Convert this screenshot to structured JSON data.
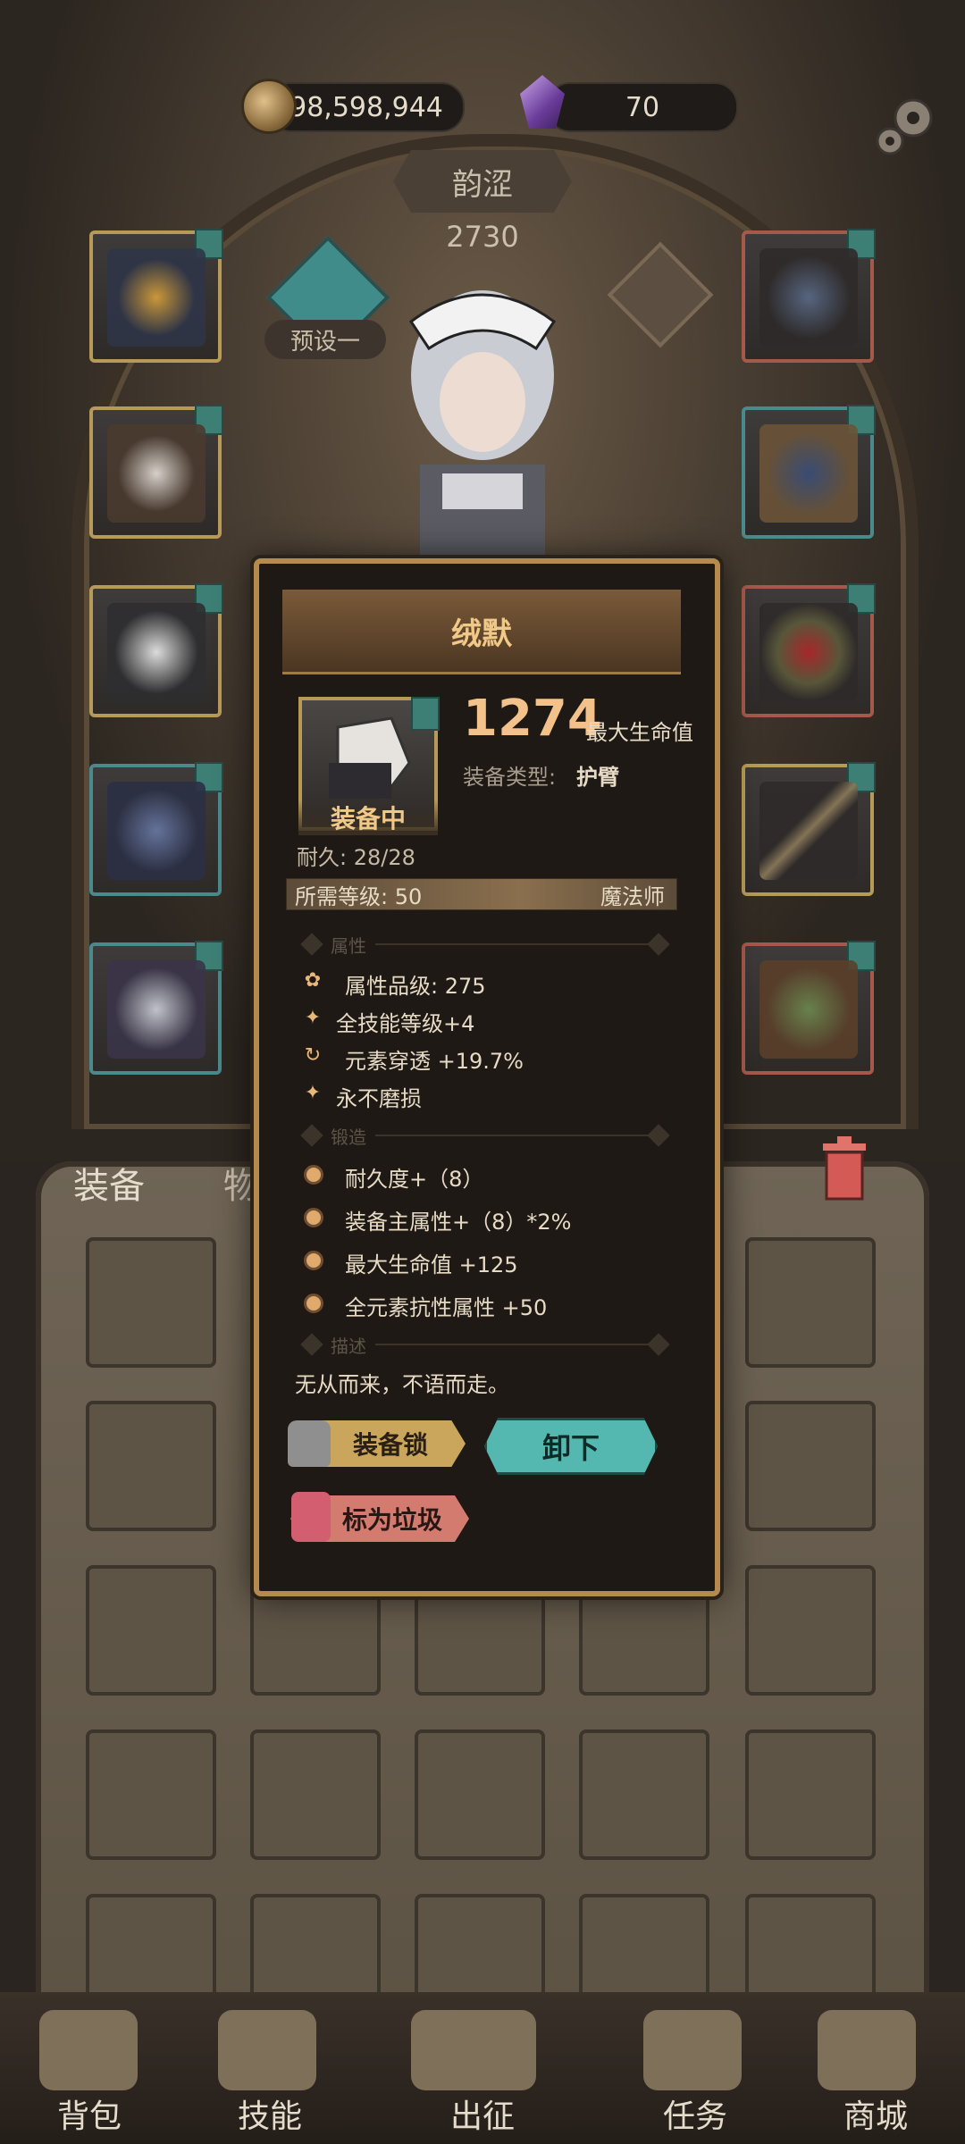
{
  "currency": {
    "gold": "98,598,944",
    "gems": "70"
  },
  "character": {
    "name": "韵涩",
    "level": "2730",
    "preset_label": "预设一"
  },
  "tabs": {
    "equip": "装备",
    "items": "物品"
  },
  "item": {
    "name": "绒默",
    "equipped_tag": "装备中",
    "stat_value": "1274",
    "stat_name": "最大生命值",
    "type_label": "装备类型:",
    "type_value": "护臂",
    "durability": "耐久: 28/28",
    "required_level": "所需等级: 50",
    "required_class": "魔法师",
    "sections": {
      "attributes": "属性",
      "forge": "锻造",
      "description": "描述"
    },
    "attributes": [
      "属性品级: 275",
      "全技能等级+4",
      "元素穿透 +19.7%",
      "永不磨损"
    ],
    "forge": [
      "耐久度+（8）",
      "装备主属性+（8）*2%",
      "最大生命值 +125",
      "全元素抗性属性 +50"
    ],
    "description": "无从而来，不语而走。",
    "buttons": {
      "lock": "装备锁",
      "unequip": "卸下",
      "mark_junk": "标为垃圾"
    }
  },
  "nav": [
    "背包",
    "技能",
    "出征",
    "任务",
    "商城"
  ]
}
